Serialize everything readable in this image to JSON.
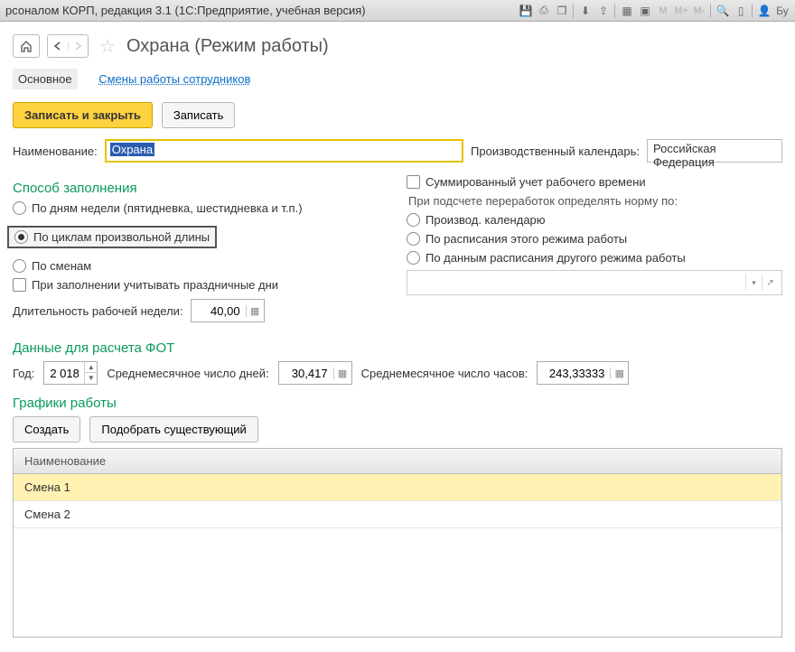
{
  "titlebar": {
    "text": "рсоналом КОРП, редакция 3.1  (1С:Предприятие, учебная версия)",
    "user": "Бу"
  },
  "page": {
    "title": "Охрана (Режим работы)"
  },
  "tabs": {
    "main": "Основное",
    "shifts": "Смены работы сотрудников"
  },
  "buttons": {
    "save_close": "Записать и закрыть",
    "save": "Записать",
    "create": "Создать",
    "pick": "Подобрать существующий"
  },
  "labels": {
    "name": "Наименование:",
    "cal": "Производственный календарь:",
    "fill_method": "Способ заполнения",
    "by_weekdays": "По дням недели (пятидневка, шестидневка и т.п.)",
    "by_cycles": "По циклам произвольной длины",
    "by_shifts": "По сменам",
    "use_holidays": "При заполнении учитывать праздничные дни",
    "week_len": "Длительность рабочей недели:",
    "summed": "Суммированный учет рабочего времени",
    "overtime_by": "При подсчете переработок определять норму по:",
    "o1": "Производ. календарю",
    "o2": "По расписания этого режима работы",
    "o3": "По данным расписания другого режима работы",
    "fot": "Данные для расчета ФОТ",
    "year": "Год:",
    "avg_days": "Среднемесячное число дней:",
    "avg_hours": "Среднемесячное число часов:",
    "schedules": "Графики работы",
    "col_name": "Наименование"
  },
  "values": {
    "name_selected": "Охрана",
    "calendar": "Российская Федерация",
    "week_len": "40,00",
    "year": "2 018",
    "avg_days": "30,417",
    "avg_hours": "243,33333"
  },
  "rows": [
    "Смена 1",
    "Смена 2"
  ]
}
